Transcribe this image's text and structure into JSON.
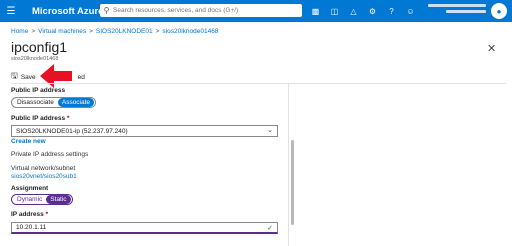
{
  "topbar": {
    "brand": "Microsoft Azure",
    "search_placeholder": "Search resources, services, and docs (G+/)",
    "icons": [
      "cloud-shell-icon",
      "directory-filter-icon",
      "notifications-icon",
      "settings-icon",
      "help-icon",
      "feedback-icon"
    ]
  },
  "breadcrumb": {
    "items": [
      "Home",
      "Virtual machines",
      "SIOS20LKNODE01",
      "sios20lknode01468"
    ],
    "separator": ">"
  },
  "blade": {
    "title": "ipconfig1",
    "subtitle": "sios20lknode01468",
    "close_glyph": "✕"
  },
  "toolbar": {
    "save_label": "Save",
    "discard_label": "ed"
  },
  "form": {
    "public_ip_label": "Public IP address",
    "public_ip_options": [
      "Disassociate",
      "Associate"
    ],
    "public_ip_selected": "Associate",
    "public_ip_field_label": "Public IP address",
    "public_ip_value": "SIOS20LKNODE01-ip (52.237.97.240)",
    "create_new": "Create new",
    "private_ip_settings": "Private IP address settings",
    "vnet_label": "Virtual network/subnet",
    "vnet_value": "sios20vnet/sios20sub1",
    "assignment_label": "Assignment",
    "assignment_options": [
      "Dynamic",
      "Static"
    ],
    "assignment_selected": "Static",
    "ip_label": "IP address",
    "ip_value": "10.20.1.11",
    "required_mark": "*"
  },
  "colors": {
    "brand_blue": "#0078d4",
    "toggle_purple": "#5c2d91",
    "annotation_red": "#e81123"
  }
}
